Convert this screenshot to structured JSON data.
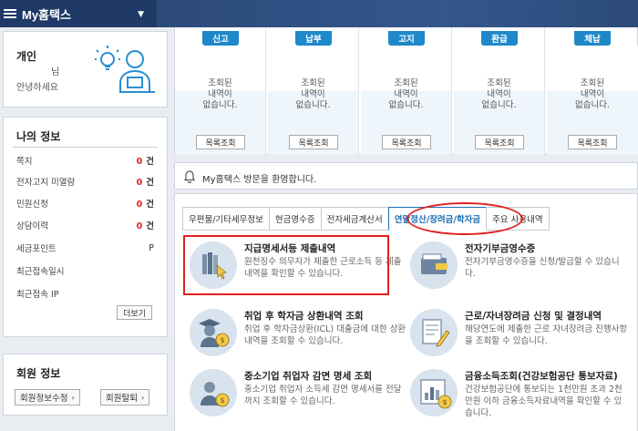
{
  "app": {
    "title": "My홈택스"
  },
  "profile": {
    "type": "개인",
    "name_suffix": "님",
    "greeting": "안녕하세요"
  },
  "my_info": {
    "title": "나의 정보",
    "rows": [
      {
        "label": "쪽지",
        "count": "0",
        "unit": "건"
      },
      {
        "label": "전자고지 미열람",
        "count": "0",
        "unit": "건"
      },
      {
        "label": "민원신청",
        "count": "0",
        "unit": "건"
      },
      {
        "label": "상담이력",
        "count": "0",
        "unit": "건"
      },
      {
        "label": "세금포인트",
        "value": "P"
      },
      {
        "label": "최근접속일시"
      },
      {
        "label": "최근접속 IP"
      }
    ],
    "more_label": "더보기"
  },
  "member": {
    "title": "회원 정보",
    "edit_label": "회원정보수정",
    "withdraw_label": "회원탈퇴"
  },
  "status_cards": [
    {
      "tag": "신고",
      "msg1": "조회된",
      "msg2": "내역이",
      "msg3": "없습니다.",
      "button": "목록조회"
    },
    {
      "tag": "납부",
      "msg1": "조회된",
      "msg2": "내역이",
      "msg3": "없습니다.",
      "button": "목록조회"
    },
    {
      "tag": "고지",
      "msg1": "조회된",
      "msg2": "내역이",
      "msg3": "없습니다.",
      "button": "목록조회"
    },
    {
      "tag": "환급",
      "msg1": "조회된",
      "msg2": "내역이",
      "msg3": "없습니다.",
      "button": "목록조회"
    },
    {
      "tag": "체납",
      "msg1": "조회된",
      "msg2": "내역이",
      "msg3": "없습니다.",
      "button": "목록조회"
    }
  ],
  "welcome": {
    "text": "My홈택스 방문을 환영합니다."
  },
  "tabs": [
    {
      "label": "우편물/기타세무정보"
    },
    {
      "label": "현금영수증"
    },
    {
      "label": "전자세금계산서"
    },
    {
      "label": "연말정산/장려금/학자금"
    },
    {
      "label": "주요 사용내역"
    }
  ],
  "items": [
    {
      "title": "지급명세서등 제출내역",
      "desc": "원천징수 의무자가 제출한 근로소득 등 제출내역을 확인할 수 있습니다."
    },
    {
      "title": "전자기부금영수증",
      "desc": "전자기부금영수증을 신청/발급할 수 있습니다."
    },
    {
      "title": "취업 후 학자금 상환내역 조회",
      "desc": "취업 후 학자금상환(ICL) 대출금에 대한 상환내역을 조회할 수 있습니다."
    },
    {
      "title": "근로/자녀장려금 신청 및 결정내역",
      "desc": "해당연도에 제출한 근로 자녀장려금 진행사항을 조회할 수 있습니다."
    },
    {
      "title": "중소기업 취업자 감면 명세 조회",
      "desc": "중소기업 취업자 소득세 감면 명세서를 전달까지 조회할 수 있습니다."
    },
    {
      "title": "금융소득조회(건강보험공단 통보자료)",
      "desc": "건강보험공단에 통보되는 1천만원 초과 2천만원 이하 금융소득자료내역을 확인할 수 있습니다."
    }
  ]
}
